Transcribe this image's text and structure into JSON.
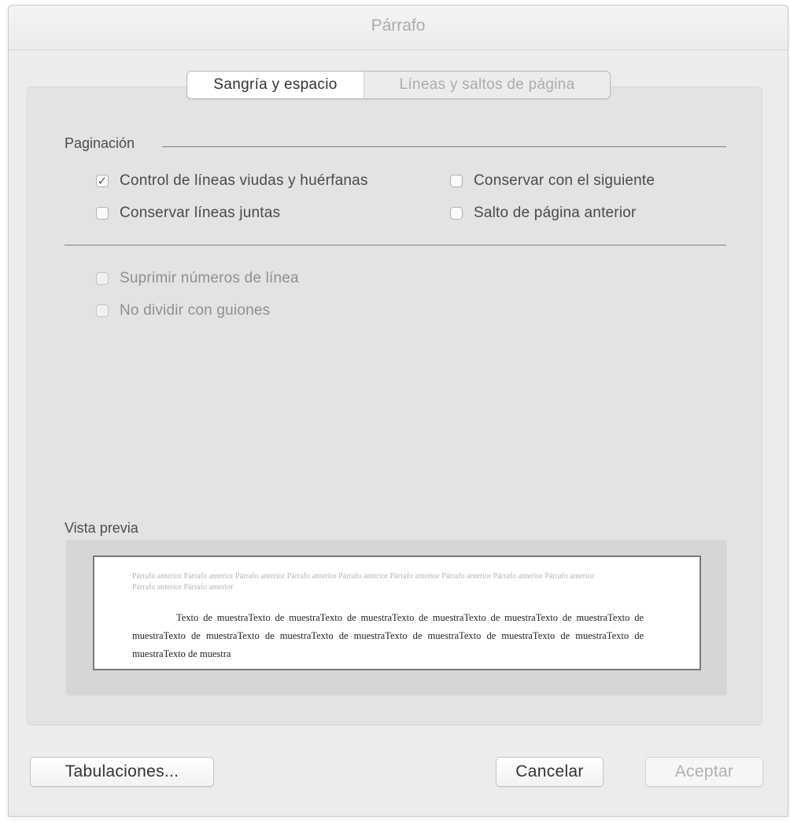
{
  "window": {
    "title": "Párrafo"
  },
  "tabs": [
    {
      "label": "Sangría y espacio",
      "active": true
    },
    {
      "label": "Líneas y saltos de página",
      "active": false
    }
  ],
  "pagination": {
    "section_label": "Paginación",
    "options": [
      {
        "label": "Control de líneas viudas y huérfanas",
        "checked": true
      },
      {
        "label": "Conservar con el siguiente",
        "checked": false
      },
      {
        "label": "Conservar líneas juntas",
        "checked": false
      },
      {
        "label": "Salto de página anterior",
        "checked": false
      }
    ]
  },
  "other_options": [
    {
      "label": "Suprimir números de línea",
      "checked": false
    },
    {
      "label": "No dividir con guiones",
      "checked": false
    }
  ],
  "preview": {
    "label": "Vista previa",
    "previous_paragraph": "Párrafo anterior Párrafo anterior Párrafo anterior Párrafo anterior Párrafo anterior Párrafo anterior Párrafo anterior Párrafo anterior Párrafo anterior Párrafo anterior Párrafo anterior",
    "sample_text": "Texto de muestraTexto de muestraTexto de muestraTexto de muestraTexto de muestraTexto de muestraTexto de muestraTexto de muestraTexto de muestraTexto de muestraTexto de muestraTexto de muestraTexto de muestraTexto de muestraTexto de muestra"
  },
  "buttons": {
    "tabs_button": "Tabulaciones...",
    "cancel": "Cancelar",
    "ok": "Aceptar"
  },
  "icons": {
    "checkmark": "✓"
  }
}
